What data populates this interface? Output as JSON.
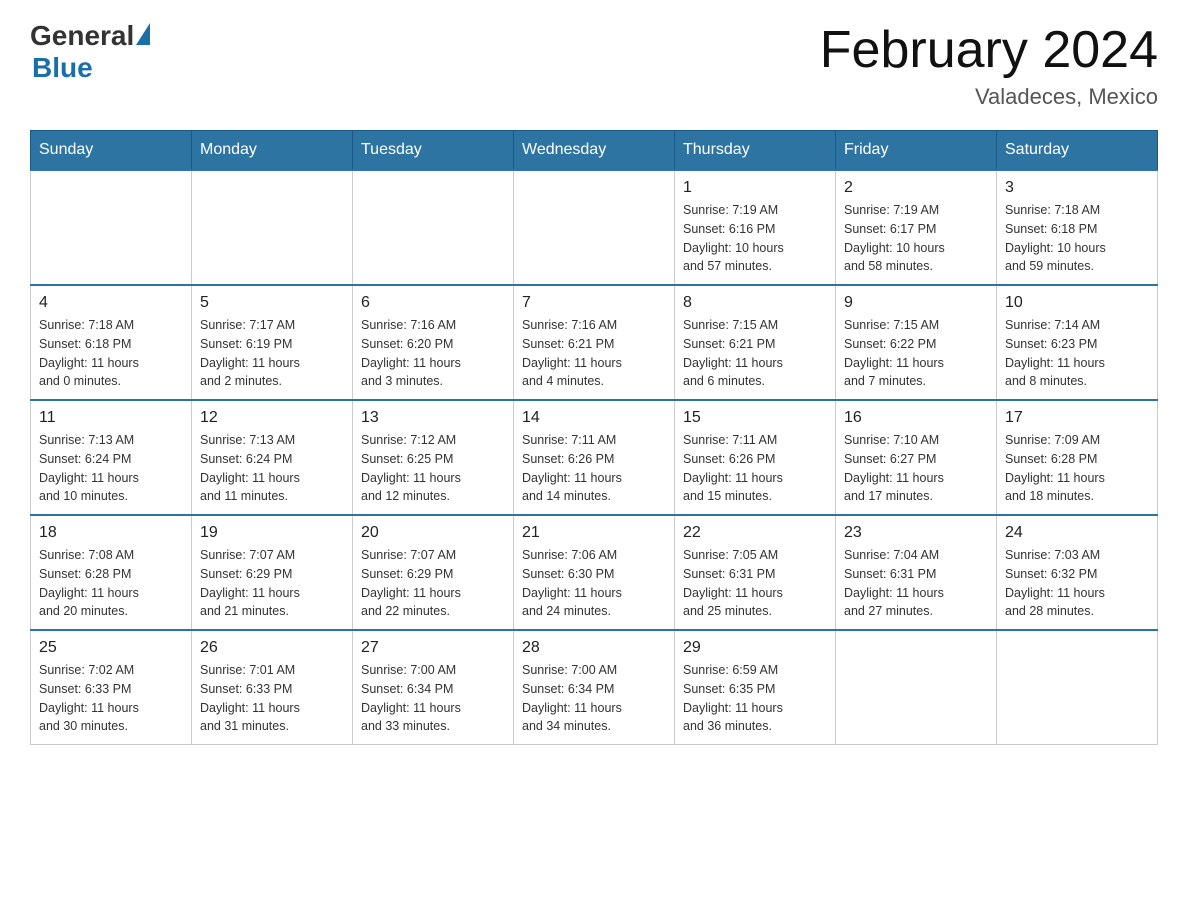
{
  "header": {
    "logo": {
      "general": "General",
      "blue": "Blue"
    },
    "title": "February 2024",
    "subtitle": "Valadeces, Mexico"
  },
  "calendar": {
    "days_of_week": [
      "Sunday",
      "Monday",
      "Tuesday",
      "Wednesday",
      "Thursday",
      "Friday",
      "Saturday"
    ],
    "weeks": [
      [
        {
          "day": "",
          "info": ""
        },
        {
          "day": "",
          "info": ""
        },
        {
          "day": "",
          "info": ""
        },
        {
          "day": "",
          "info": ""
        },
        {
          "day": "1",
          "info": "Sunrise: 7:19 AM\nSunset: 6:16 PM\nDaylight: 10 hours\nand 57 minutes."
        },
        {
          "day": "2",
          "info": "Sunrise: 7:19 AM\nSunset: 6:17 PM\nDaylight: 10 hours\nand 58 minutes."
        },
        {
          "day": "3",
          "info": "Sunrise: 7:18 AM\nSunset: 6:18 PM\nDaylight: 10 hours\nand 59 minutes."
        }
      ],
      [
        {
          "day": "4",
          "info": "Sunrise: 7:18 AM\nSunset: 6:18 PM\nDaylight: 11 hours\nand 0 minutes."
        },
        {
          "day": "5",
          "info": "Sunrise: 7:17 AM\nSunset: 6:19 PM\nDaylight: 11 hours\nand 2 minutes."
        },
        {
          "day": "6",
          "info": "Sunrise: 7:16 AM\nSunset: 6:20 PM\nDaylight: 11 hours\nand 3 minutes."
        },
        {
          "day": "7",
          "info": "Sunrise: 7:16 AM\nSunset: 6:21 PM\nDaylight: 11 hours\nand 4 minutes."
        },
        {
          "day": "8",
          "info": "Sunrise: 7:15 AM\nSunset: 6:21 PM\nDaylight: 11 hours\nand 6 minutes."
        },
        {
          "day": "9",
          "info": "Sunrise: 7:15 AM\nSunset: 6:22 PM\nDaylight: 11 hours\nand 7 minutes."
        },
        {
          "day": "10",
          "info": "Sunrise: 7:14 AM\nSunset: 6:23 PM\nDaylight: 11 hours\nand 8 minutes."
        }
      ],
      [
        {
          "day": "11",
          "info": "Sunrise: 7:13 AM\nSunset: 6:24 PM\nDaylight: 11 hours\nand 10 minutes."
        },
        {
          "day": "12",
          "info": "Sunrise: 7:13 AM\nSunset: 6:24 PM\nDaylight: 11 hours\nand 11 minutes."
        },
        {
          "day": "13",
          "info": "Sunrise: 7:12 AM\nSunset: 6:25 PM\nDaylight: 11 hours\nand 12 minutes."
        },
        {
          "day": "14",
          "info": "Sunrise: 7:11 AM\nSunset: 6:26 PM\nDaylight: 11 hours\nand 14 minutes."
        },
        {
          "day": "15",
          "info": "Sunrise: 7:11 AM\nSunset: 6:26 PM\nDaylight: 11 hours\nand 15 minutes."
        },
        {
          "day": "16",
          "info": "Sunrise: 7:10 AM\nSunset: 6:27 PM\nDaylight: 11 hours\nand 17 minutes."
        },
        {
          "day": "17",
          "info": "Sunrise: 7:09 AM\nSunset: 6:28 PM\nDaylight: 11 hours\nand 18 minutes."
        }
      ],
      [
        {
          "day": "18",
          "info": "Sunrise: 7:08 AM\nSunset: 6:28 PM\nDaylight: 11 hours\nand 20 minutes."
        },
        {
          "day": "19",
          "info": "Sunrise: 7:07 AM\nSunset: 6:29 PM\nDaylight: 11 hours\nand 21 minutes."
        },
        {
          "day": "20",
          "info": "Sunrise: 7:07 AM\nSunset: 6:29 PM\nDaylight: 11 hours\nand 22 minutes."
        },
        {
          "day": "21",
          "info": "Sunrise: 7:06 AM\nSunset: 6:30 PM\nDaylight: 11 hours\nand 24 minutes."
        },
        {
          "day": "22",
          "info": "Sunrise: 7:05 AM\nSunset: 6:31 PM\nDaylight: 11 hours\nand 25 minutes."
        },
        {
          "day": "23",
          "info": "Sunrise: 7:04 AM\nSunset: 6:31 PM\nDaylight: 11 hours\nand 27 minutes."
        },
        {
          "day": "24",
          "info": "Sunrise: 7:03 AM\nSunset: 6:32 PM\nDaylight: 11 hours\nand 28 minutes."
        }
      ],
      [
        {
          "day": "25",
          "info": "Sunrise: 7:02 AM\nSunset: 6:33 PM\nDaylight: 11 hours\nand 30 minutes."
        },
        {
          "day": "26",
          "info": "Sunrise: 7:01 AM\nSunset: 6:33 PM\nDaylight: 11 hours\nand 31 minutes."
        },
        {
          "day": "27",
          "info": "Sunrise: 7:00 AM\nSunset: 6:34 PM\nDaylight: 11 hours\nand 33 minutes."
        },
        {
          "day": "28",
          "info": "Sunrise: 7:00 AM\nSunset: 6:34 PM\nDaylight: 11 hours\nand 34 minutes."
        },
        {
          "day": "29",
          "info": "Sunrise: 6:59 AM\nSunset: 6:35 PM\nDaylight: 11 hours\nand 36 minutes."
        },
        {
          "day": "",
          "info": ""
        },
        {
          "day": "",
          "info": ""
        }
      ]
    ]
  }
}
